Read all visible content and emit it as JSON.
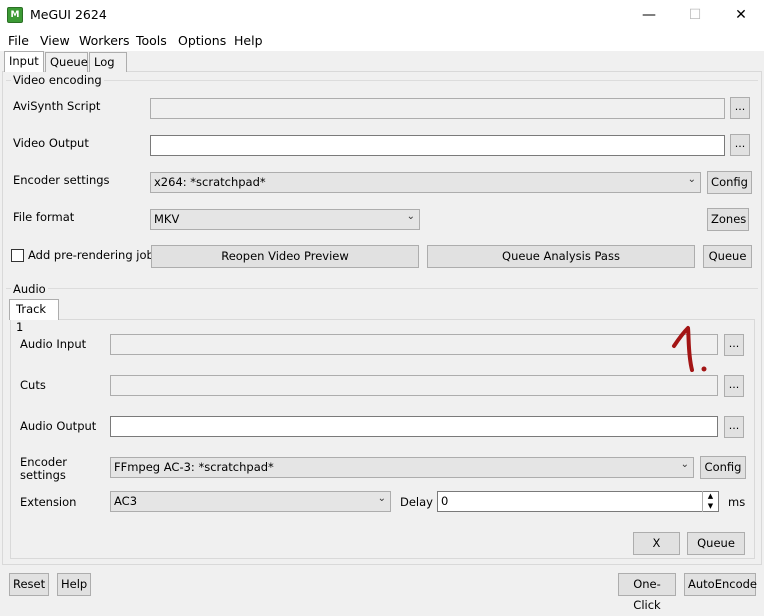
{
  "window": {
    "title": "MeGUI 2624",
    "icon_text": "M"
  },
  "menu": [
    "File",
    "View",
    "Workers",
    "Tools",
    "Options",
    "Help"
  ],
  "tabs": [
    "Input",
    "Queue",
    "Log"
  ],
  "video": {
    "group_title": "Video encoding",
    "avisynth_label": "AviSynth Script",
    "avisynth_value": "",
    "output_label": "Video Output",
    "output_value": "",
    "encoder_label": "Encoder settings",
    "encoder_value": "x264: *scratchpad*",
    "config_label": "Config",
    "format_label": "File format",
    "format_value": "MKV",
    "zones_label": "Zones",
    "prerender_label": "Add pre-rendering job",
    "prerender_checked": false,
    "reopen_label": "Reopen Video Preview",
    "analysis_label": "Queue Analysis Pass",
    "queue_label": "Queue",
    "browse_label": "..."
  },
  "audio": {
    "group_title": "Audio",
    "track_tab": "Track 1",
    "input_label": "Audio Input",
    "input_value": "",
    "cuts_label": "Cuts",
    "cuts_value": "",
    "output_label": "Audio Output",
    "output_value": "",
    "encoder_label_1": "Encoder",
    "encoder_label_2": "settings",
    "encoder_value": "FFmpeg AC-3: *scratchpad*",
    "config_label": "Config",
    "extension_label": "Extension",
    "extension_value": "AC3",
    "delay_label": "Delay",
    "delay_value": "0",
    "delay_unit": "ms",
    "x_label": "X",
    "queue_label": "Queue",
    "browse_label": "..."
  },
  "footer": {
    "reset_label": "Reset",
    "help_label": "Help",
    "oneclick_label": "One-Click",
    "autoencode_label": "AutoEncode"
  },
  "annotation_text": "1.",
  "colors": {
    "annotation": "#a31515",
    "window_bg": "#f0f0f0"
  }
}
